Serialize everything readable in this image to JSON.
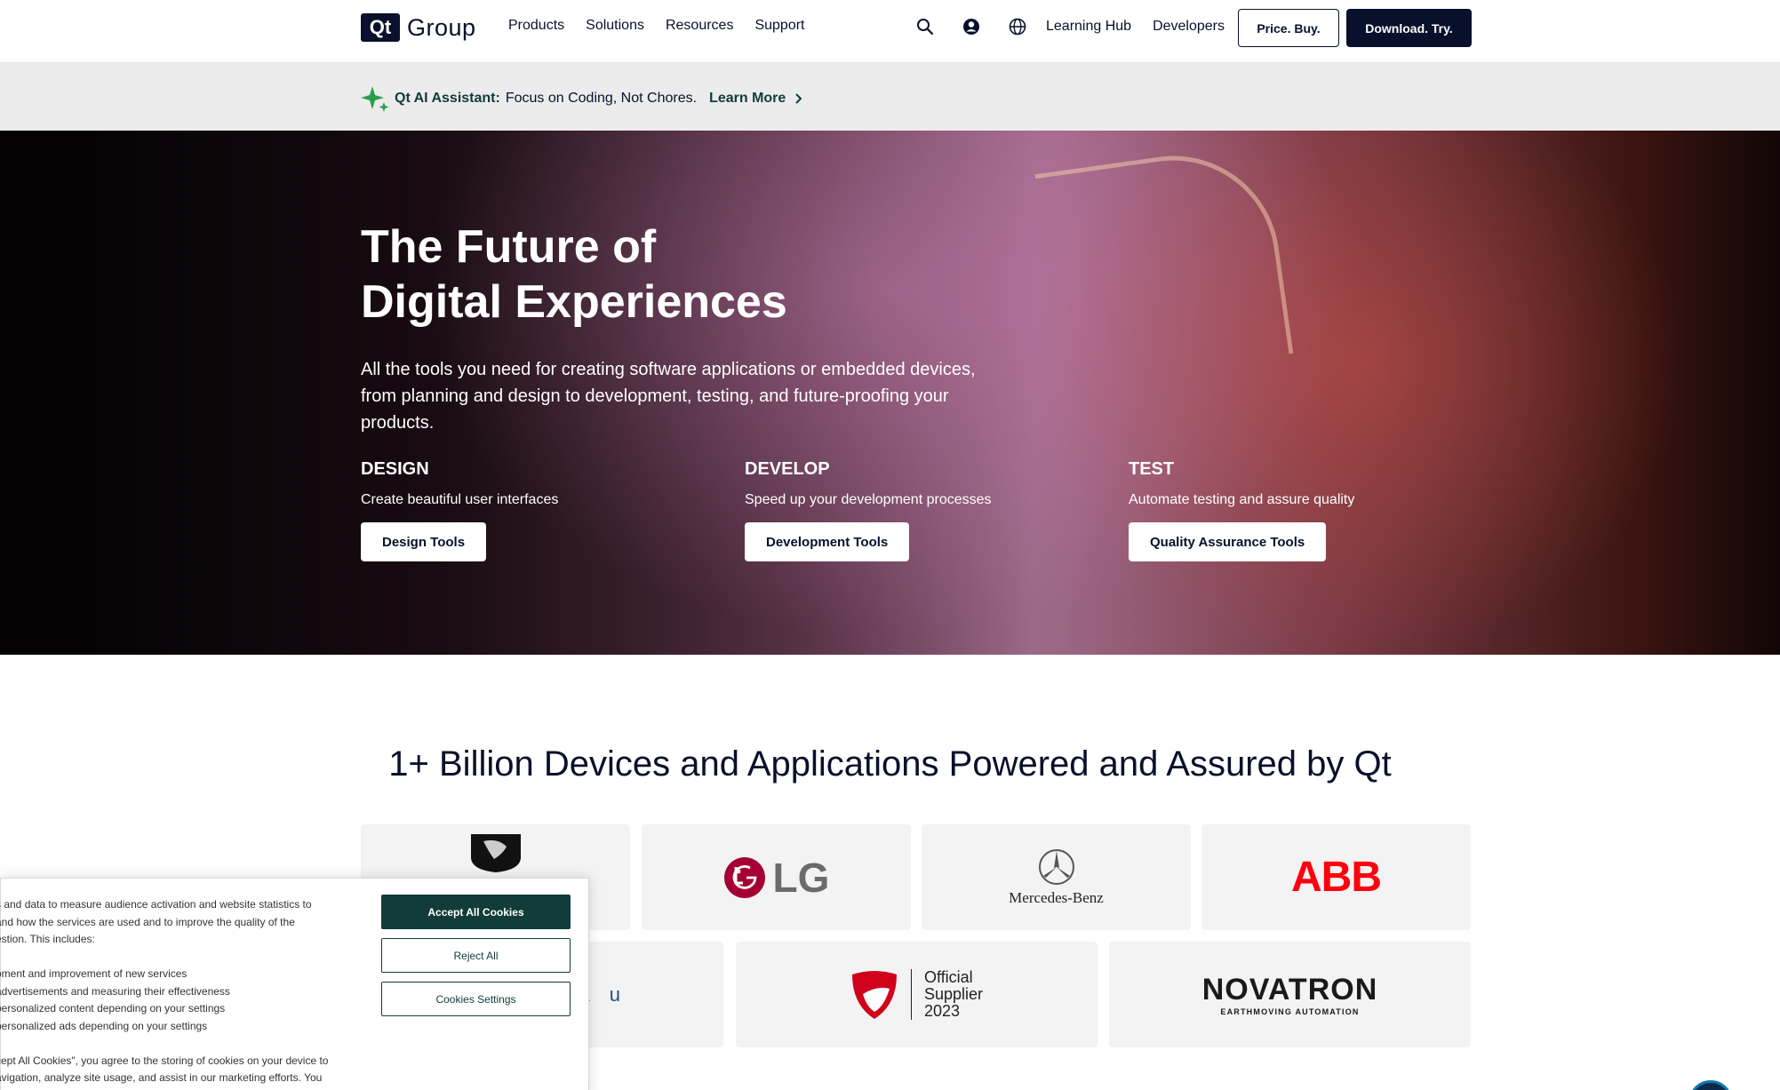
{
  "header": {
    "logo_box": "Qt",
    "logo_word": "Group",
    "nav": [
      "Products",
      "Solutions",
      "Resources",
      "Support"
    ],
    "icons": [
      "search-icon",
      "account-icon",
      "globe-icon"
    ],
    "links": [
      "Learning Hub",
      "Developers"
    ],
    "price_button": "Price. Buy.",
    "download_button": "Download. Try."
  },
  "announcement": {
    "icon": "sparkle-icon",
    "bold": "Qt AI Assistant:",
    "text": "Focus on Coding, Not Chores.",
    "link": "Learn More",
    "link_icon": "chevron-right-icon",
    "icon_color": "#2a9d4b"
  },
  "hero": {
    "title_line1": "The Future of",
    "title_line2": "Digital Experiences",
    "subtitle": "All the tools you need for creating software applications or embedded devices, from planning and design to development, testing, and future-proofing your products.",
    "pillars": [
      {
        "heading": "DESIGN",
        "desc": "Create beautiful user interfaces",
        "button": "Design Tools"
      },
      {
        "heading": "DEVELOP",
        "desc": "Speed up your development processes",
        "button": "Development Tools"
      },
      {
        "heading": "TEST",
        "desc": "Automate testing and assure quality",
        "button": "Quality Assurance Tools"
      }
    ]
  },
  "devices": {
    "title": "1+ Billion Devices and Applications Powered and Assured by Qt",
    "logos": {
      "lg": "LG",
      "mercedes": "Mercedes-Benz",
      "abb": "ABB",
      "partial": "a u",
      "ducati_line1": "Official",
      "ducati_line2": "Supplier",
      "ducati_line3": "2023",
      "novatron": "NOVATRON",
      "novatron_sub": "EARTHMOVING AUTOMATION"
    }
  },
  "cookie": {
    "lines": [
      "s and data to measure audience activation and website statistics to",
      "and how the services are used and to improve the quality of the",
      "estion. This includes:"
    ],
    "bullets": [
      "oment and improvement of new services",
      "advertisements and measuring their effectiveness",
      "personalized content depending on your settings",
      "personalized ads depending on your settings"
    ],
    "footer_lines": [
      "cept All Cookies\", you agree to the storing of cookies on your device to",
      "avigation, analyze site usage, and assist in our marketing efforts. You"
    ],
    "accept": "Accept All Cookies",
    "reject": "Reject All",
    "settings": "Cookies Settings"
  }
}
